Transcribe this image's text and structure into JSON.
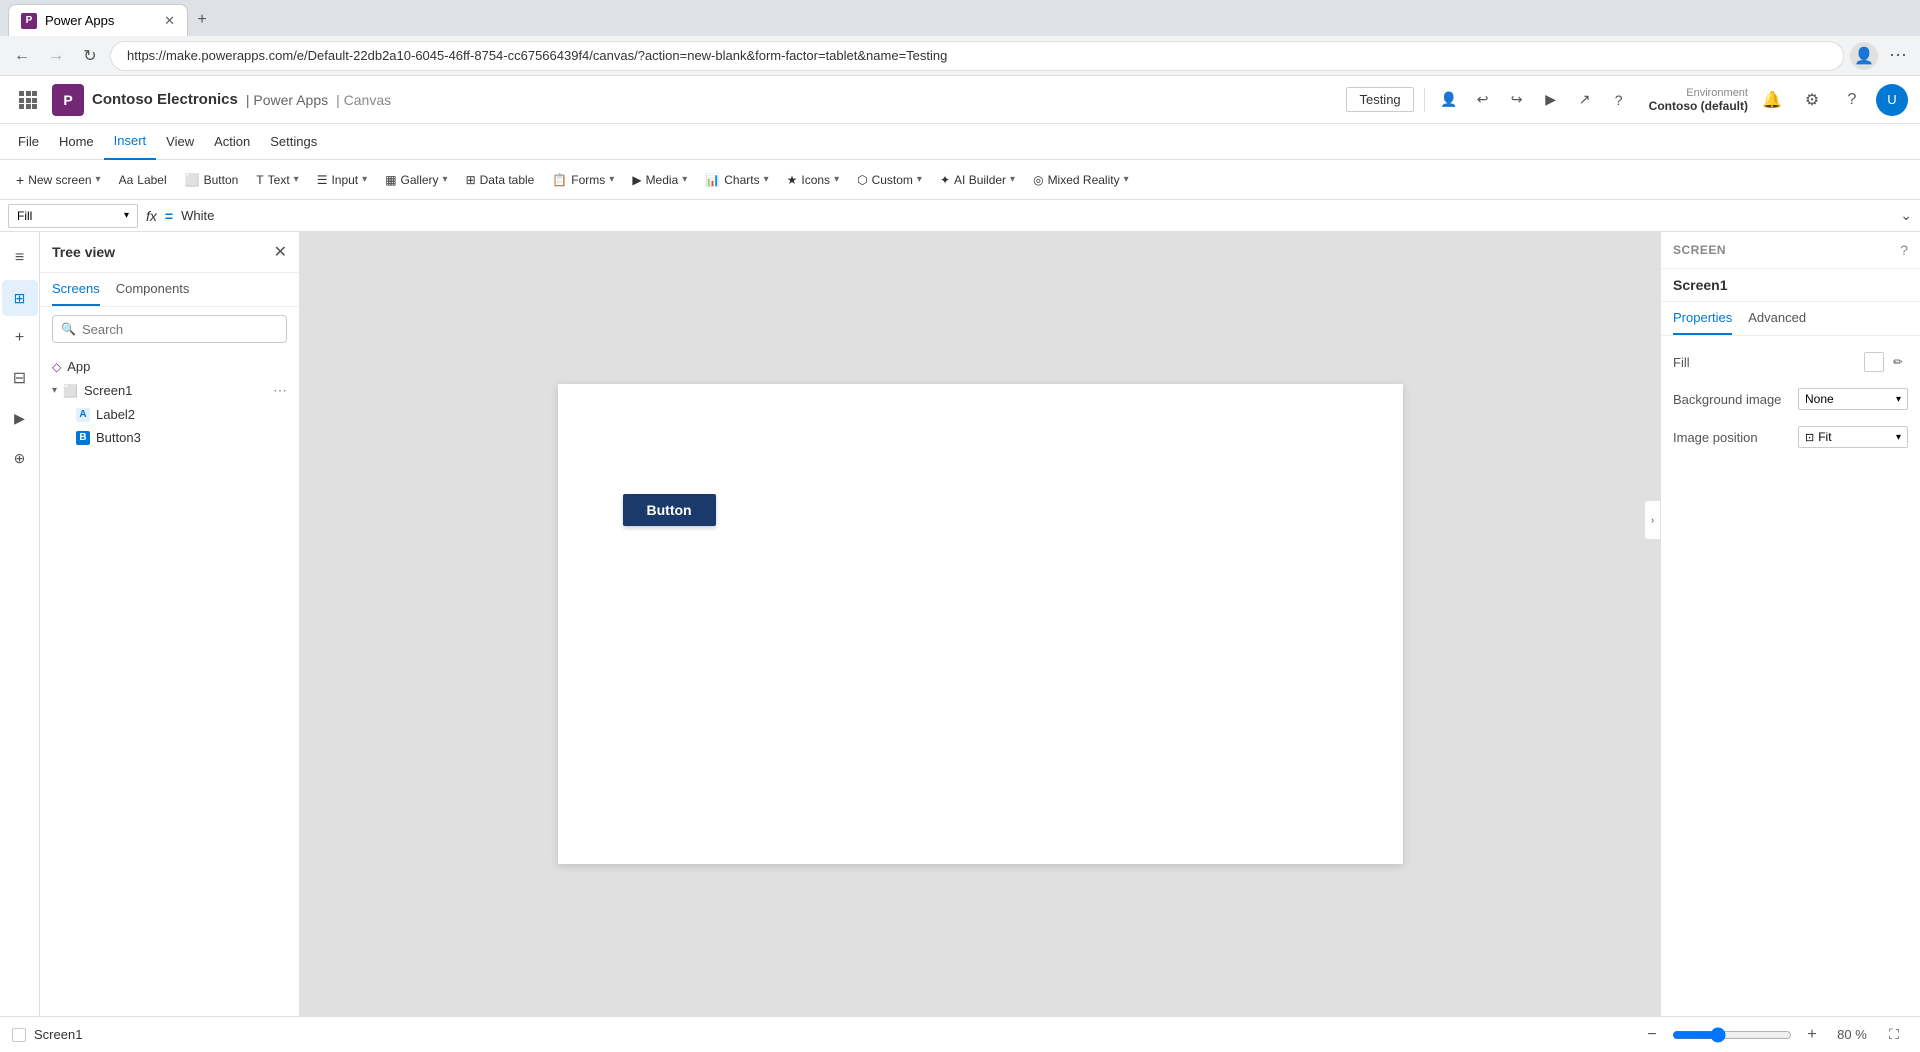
{
  "browser": {
    "tab_label": "Power Apps",
    "url": "https://make.powerapps.com/e/Default-22db2a10-6045-46ff-8754-cc67566439f4/canvas/?action=new-blank&form-factor=tablet&name=Testing",
    "new_tab_symbol": "+",
    "back_symbol": "←",
    "forward_symbol": "→",
    "refresh_symbol": "↻"
  },
  "app_header": {
    "brand": "Contoso Electronics",
    "product": "Power Apps",
    "pipe": "|",
    "canvas": "Canvas",
    "env_label": "Environment",
    "env_name": "Contoso (default)",
    "app_name": "Testing"
  },
  "menu": {
    "items": [
      {
        "id": "file",
        "label": "File"
      },
      {
        "id": "home",
        "label": "Home"
      },
      {
        "id": "insert",
        "label": "Insert"
      },
      {
        "id": "view",
        "label": "View"
      },
      {
        "id": "action",
        "label": "Action"
      },
      {
        "id": "settings",
        "label": "Settings"
      }
    ]
  },
  "insert_toolbar": {
    "items": [
      {
        "id": "new-screen",
        "label": "New screen",
        "has_arrow": true
      },
      {
        "id": "label",
        "label": "Label"
      },
      {
        "id": "button",
        "label": "Button"
      },
      {
        "id": "text",
        "label": "Text",
        "has_arrow": true
      },
      {
        "id": "input",
        "label": "Input",
        "has_arrow": true
      },
      {
        "id": "gallery",
        "label": "Gallery",
        "has_arrow": true
      },
      {
        "id": "data-table",
        "label": "Data table"
      },
      {
        "id": "forms",
        "label": "Forms",
        "has_arrow": true
      },
      {
        "id": "media",
        "label": "Media",
        "has_arrow": true
      },
      {
        "id": "charts",
        "label": "Charts",
        "has_arrow": true
      },
      {
        "id": "icons",
        "label": "Icons",
        "has_arrow": true
      },
      {
        "id": "custom",
        "label": "Custom",
        "has_arrow": true
      },
      {
        "id": "ai-builder",
        "label": "AI Builder",
        "has_arrow": true
      },
      {
        "id": "mixed-reality",
        "label": "Mixed Reality",
        "has_arrow": true
      }
    ]
  },
  "formula_bar": {
    "dropdown_value": "Fill",
    "equals_sign": "=",
    "fx_label": "fx",
    "formula_value": "White"
  },
  "tree_view": {
    "title": "Tree view",
    "tabs": [
      {
        "id": "screens",
        "label": "Screens"
      },
      {
        "id": "components",
        "label": "Components"
      }
    ],
    "search_placeholder": "Search",
    "items": [
      {
        "id": "app",
        "label": "App",
        "icon": "app",
        "level": 0
      },
      {
        "id": "screen1",
        "label": "Screen1",
        "icon": "screen",
        "level": 0,
        "expanded": true,
        "children": [
          {
            "id": "label2",
            "label": "Label2",
            "icon": "label",
            "level": 1
          },
          {
            "id": "button3",
            "label": "Button3",
            "icon": "button",
            "level": 1
          }
        ]
      }
    ]
  },
  "canvas": {
    "button_label": "Button"
  },
  "right_panel": {
    "section_label": "SCREEN",
    "screen_name": "Screen1",
    "tabs": [
      {
        "id": "properties",
        "label": "Properties"
      },
      {
        "id": "advanced",
        "label": "Advanced"
      }
    ],
    "fill_label": "Fill",
    "background_image_label": "Background image",
    "background_image_value": "None",
    "image_position_label": "Image position",
    "image_position_value": "Fit"
  },
  "bottom_bar": {
    "screen_name": "Screen1",
    "zoom_minus": "−",
    "zoom_plus": "+",
    "zoom_level": "80 %",
    "expand_icon": "⛶"
  },
  "left_sidebar": {
    "icons": [
      {
        "id": "menu",
        "symbol": "≡"
      },
      {
        "id": "screens",
        "symbol": "⊞"
      },
      {
        "id": "insert",
        "symbol": "+"
      },
      {
        "id": "data",
        "symbol": "⊟"
      },
      {
        "id": "media",
        "symbol": "▶"
      },
      {
        "id": "variables",
        "symbol": "⊕"
      }
    ]
  }
}
